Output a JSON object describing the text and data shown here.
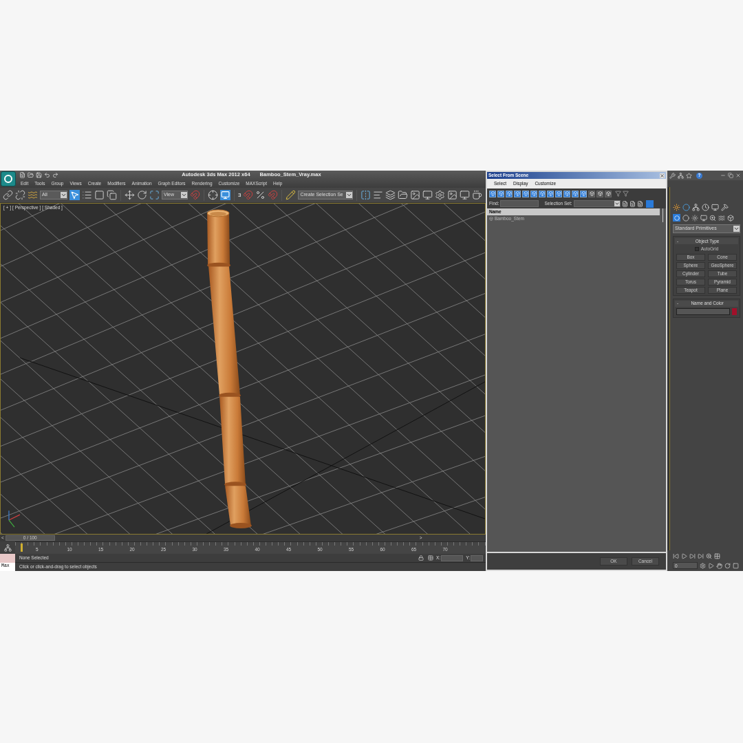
{
  "title_bar": {
    "app": "Autodesk 3ds Max  2012 x64",
    "file": "Bamboo_Stem_Vray.max"
  },
  "menu": [
    "Edit",
    "Tools",
    "Group",
    "Views",
    "Create",
    "Modifiers",
    "Animation",
    "Graph Editors",
    "Rendering",
    "Customize",
    "MAXScript",
    "Help"
  ],
  "toolbar": {
    "filter": "All",
    "select_active": true,
    "ref_coord": "View",
    "gizmo_active": true,
    "snap_number": "3",
    "selection_set": "Create Selection Se"
  },
  "viewport": {
    "labels": [
      "[ + ]",
      "[ Perspective ]",
      "[ Shaded ]"
    ]
  },
  "timeline": {
    "prev": "<",
    "next": ">",
    "frame": "0 / 100",
    "level": 0,
    "ticks": [
      "5",
      "10",
      "15",
      "20",
      "25",
      "30",
      "35",
      "40",
      "45",
      "50",
      "55",
      "60",
      "65",
      "70"
    ]
  },
  "status": {
    "listener": "Max",
    "selection": "None Selected",
    "prompt": "Click or click-and-drag to select objects",
    "coords": [
      "X:",
      "Y:"
    ]
  },
  "dialog": {
    "title": "Select From Scene",
    "menu": [
      "Select",
      "Display",
      "Customize"
    ],
    "filters": [
      {
        "on": true
      },
      {
        "on": true
      },
      {
        "on": true
      },
      {
        "on": true
      },
      {
        "on": true
      },
      {
        "on": true
      },
      {
        "on": true
      },
      {
        "on": true
      },
      {
        "on": true
      },
      {
        "on": true
      },
      {
        "on": true
      },
      {
        "on": true
      },
      {
        "on": false
      },
      {
        "on": false
      },
      {
        "on": false
      }
    ],
    "find_label": "Find:",
    "selection_set_label": "Selection Set:",
    "column": "Name",
    "rows": [
      {
        "name": "Bamboo_Stem",
        "selected": false
      }
    ],
    "buttons": [
      "OK",
      "Cancel"
    ]
  },
  "command_panel": {
    "help": "?",
    "dropdown": "Standard Primitives",
    "rollouts": [
      {
        "toggle": "-",
        "title": "Object Type",
        "autogrid": {
          "label": "AutoGrid",
          "checked": false
        },
        "buttons": [
          "Box",
          "Cone",
          "Sphere",
          "GeoSphere",
          "Cylinder",
          "Tube",
          "Torus",
          "Pyramid",
          "Teapot",
          "Plane"
        ]
      },
      {
        "toggle": "-",
        "title": "Name and Color",
        "color": "#a0102a"
      }
    ],
    "frame": "0"
  }
}
